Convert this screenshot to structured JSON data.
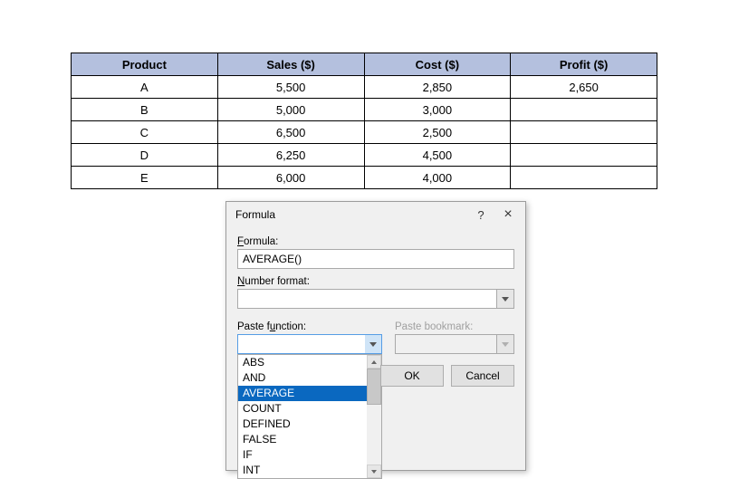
{
  "table": {
    "headers": [
      "Product",
      "Sales ($)",
      "Cost ($)",
      "Profit ($)"
    ],
    "rows": [
      {
        "product": "A",
        "sales": "5,500",
        "cost": "2,850",
        "profit": "2,650"
      },
      {
        "product": "B",
        "sales": "5,000",
        "cost": "3,000",
        "profit": ""
      },
      {
        "product": "C",
        "sales": "6,500",
        "cost": "2,500",
        "profit": ""
      },
      {
        "product": "D",
        "sales": "6,250",
        "cost": "4,500",
        "profit": ""
      },
      {
        "product": "E",
        "sales": "6,000",
        "cost": "4,000",
        "profit": ""
      }
    ]
  },
  "dialog": {
    "title": "Formula",
    "help": "?",
    "close": "×",
    "formula_label_pre": "F",
    "formula_label_post": "ormula:",
    "formula_value": "AVERAGE()",
    "numfmt_label_pre": "N",
    "numfmt_label_post": "umber format:",
    "numfmt_value": "",
    "pastefn_label_pre": "Paste f",
    "pastefn_label_post": "unction:",
    "pastebm_label": "Paste bookmark:",
    "ok": "OK",
    "cancel": "Cancel",
    "functions": [
      "ABS",
      "AND",
      "AVERAGE",
      "COUNT",
      "DEFINED",
      "FALSE",
      "IF",
      "INT"
    ],
    "selected_function_index": 2
  }
}
